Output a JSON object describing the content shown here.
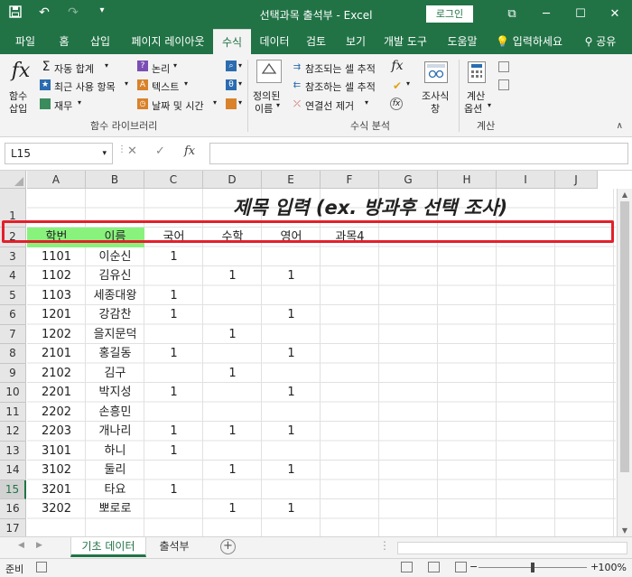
{
  "window": {
    "title": "선택과목 출석부  -  Excel",
    "login_label": "로그인"
  },
  "ribbon_tabs": [
    "파일",
    "홈",
    "삽입",
    "페이지 레이아웃",
    "수식",
    "데이터",
    "검토",
    "보기",
    "개발 도구",
    "도움말",
    "입력하세요",
    "공유"
  ],
  "active_tab": "수식",
  "ribbon": {
    "function_library": {
      "insert_function": [
        "함수",
        "삽입"
      ],
      "autosum": "자동 합계",
      "recent": "최근 사용 항목",
      "financial": "재무",
      "logical": "논리",
      "text": "텍스트",
      "datetime": "날짜 및 시간",
      "group_label": "함수 라이브러리"
    },
    "defined_names": {
      "label": [
        "정의된",
        "이름"
      ]
    },
    "formula_auditing": {
      "trace_precedents": "참조되는 셀 추적",
      "trace_dependents": "참조하는 셀 추적",
      "remove_arrows": "연결선 제거",
      "group_label": "수식 분석"
    },
    "watch_window": [
      "조사식",
      "창"
    ],
    "calculation": {
      "options": [
        "계산",
        "옵션"
      ],
      "group_label": "계산"
    }
  },
  "formula_bar": {
    "name_box": "L15",
    "formula": ""
  },
  "columns": [
    "A",
    "B",
    "C",
    "D",
    "E",
    "F",
    "G",
    "H",
    "I",
    "J"
  ],
  "rows": [
    "1",
    "2",
    "3",
    "4",
    "5",
    "6",
    "7",
    "8",
    "9",
    "10",
    "11",
    "12",
    "13",
    "14",
    "15",
    "16",
    "17"
  ],
  "selected_row": "15",
  "sheet_title": "제목 입력 (ex. 방과후 선택 조사)",
  "header_row": [
    "학번",
    "이름",
    "국어",
    "수학",
    "영어",
    "과목4"
  ],
  "data_rows": [
    [
      "1101",
      "이순신",
      "1",
      "",
      ""
    ],
    [
      "1102",
      "김유신",
      "",
      "1",
      "1"
    ],
    [
      "1103",
      "세종대왕",
      "1",
      "",
      ""
    ],
    [
      "1201",
      "강감찬",
      "1",
      "",
      "1"
    ],
    [
      "1202",
      "을지문덕",
      "",
      "1",
      ""
    ],
    [
      "2101",
      "홍길동",
      "1",
      "",
      "1"
    ],
    [
      "2102",
      "김구",
      "",
      "1",
      ""
    ],
    [
      "2201",
      "박지성",
      "1",
      "",
      "1"
    ],
    [
      "2202",
      "손흥민",
      "",
      "",
      ""
    ],
    [
      "2203",
      "개나리",
      "1",
      "1",
      "1"
    ],
    [
      "3101",
      "하니",
      "1",
      "",
      ""
    ],
    [
      "3102",
      "둘리",
      "",
      "1",
      "1"
    ],
    [
      "3201",
      "타요",
      "1",
      "",
      ""
    ],
    [
      "3202",
      "뽀로로",
      "",
      "1",
      "1"
    ]
  ],
  "sheets": [
    "기초 데이터",
    "출석부"
  ],
  "active_sheet": "기초 데이터",
  "status": {
    "ready": "준비",
    "zoom": "100%"
  },
  "colors": {
    "accent": "#217346",
    "highlight_green": "#88f27d",
    "annotation_red": "#e3202a"
  }
}
